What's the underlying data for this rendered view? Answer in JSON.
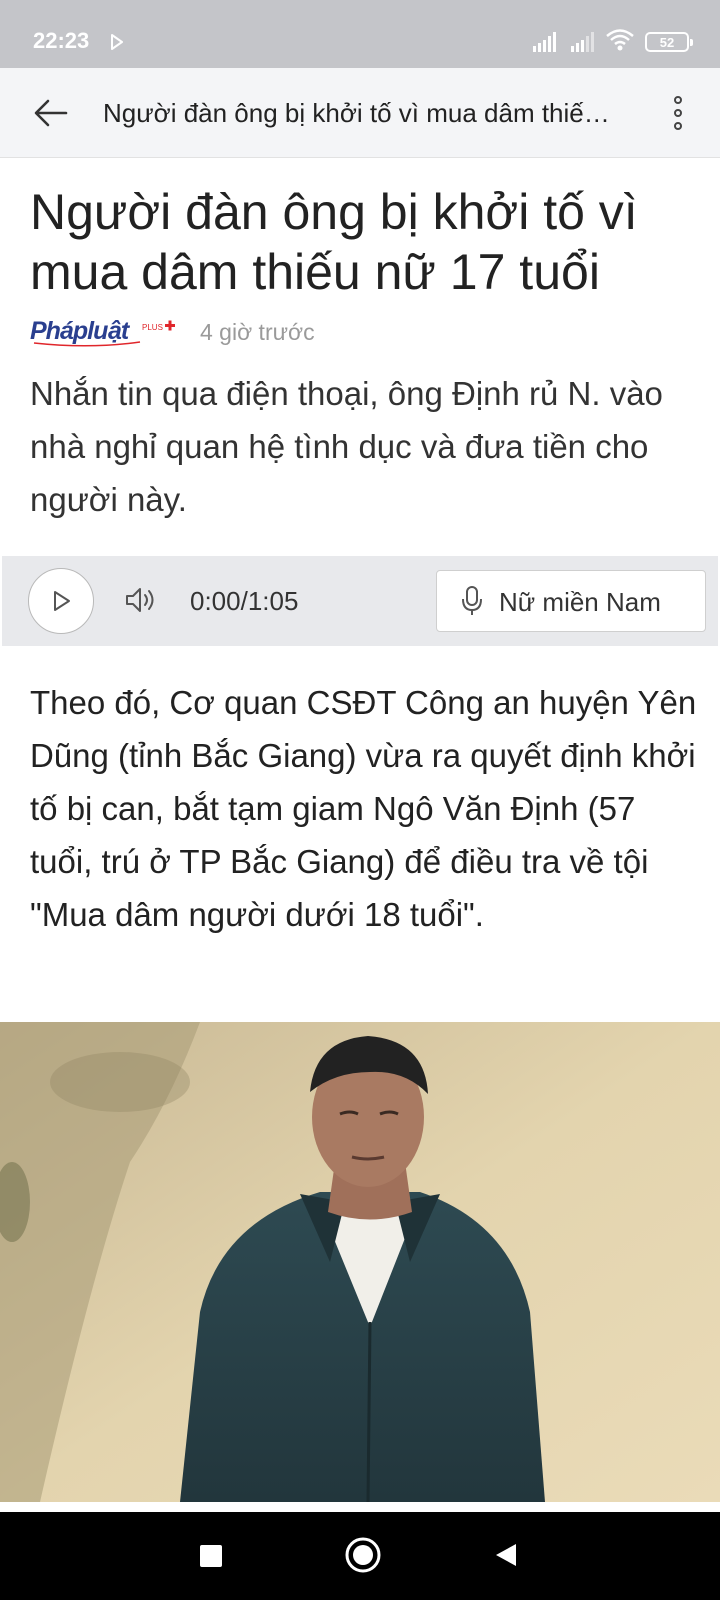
{
  "status_bar": {
    "time": "22:23",
    "battery_level": "52"
  },
  "app_bar": {
    "title": "Người đàn ông bị khởi tố vì mua dâm thiếu nữ 17 tuổi"
  },
  "article": {
    "headline": "Người đàn ông bị khởi tố vì mua dâm thiếu nữ 17 tuổi",
    "source": "Pháp luật plus",
    "publish_time": "4 giờ trước",
    "summary": "Nhắn tin qua điện thoại, ông Định rủ N. vào nhà nghỉ quan hệ tình dục và đưa tiền cho người này.",
    "body": "Theo đó, Cơ quan CSĐT Công an huyện Yên Dũng (tỉnh Bắc Giang) vừa ra quyết định khởi tố bị can, bắt tạm giam Ngô Văn Định (57 tuổi, trú ở TP Bắc Giang) để điều tra về tội \"Mua dâm người dưới 18 tuổi\"."
  },
  "audio_player": {
    "time": "0:00/1:05",
    "voice": "Nữ miền Nam"
  },
  "colors": {
    "status_bar": "#c4c5c9",
    "app_bar": "#f4f5f7",
    "audio_bg": "#e8e9ec",
    "logo_blue": "#2a3f8f",
    "logo_red": "#e0262b"
  }
}
